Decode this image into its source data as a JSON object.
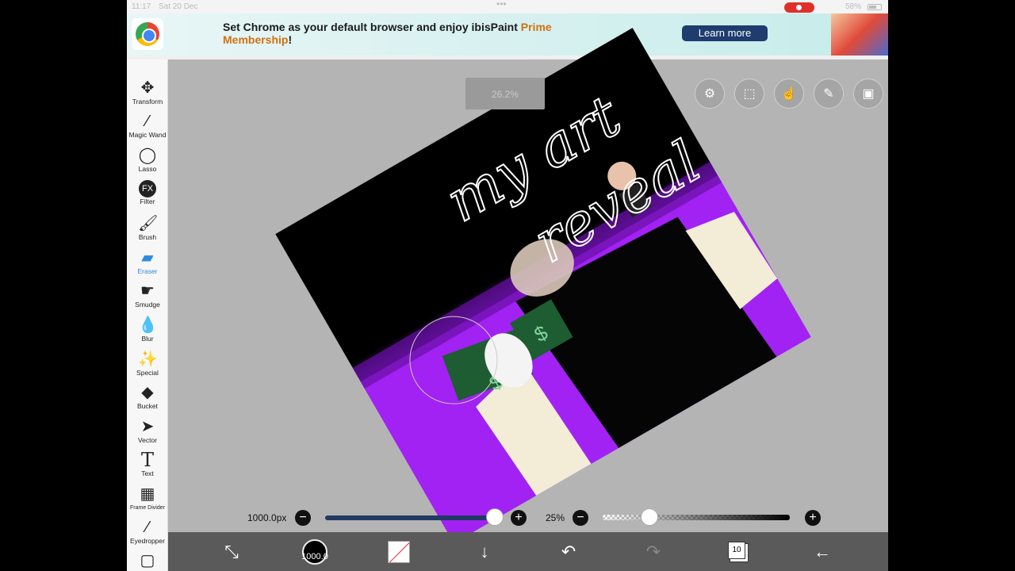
{
  "status_bar": {
    "time": "11:17",
    "date": "Sat 20 Dec",
    "battery": "58%"
  },
  "ad": {
    "message_prefix": "Set Chrome as your default browser and enjoy ibisPaint ",
    "message_highlight_1": "Prime",
    "message_highlight_2": "Membership",
    "message_suffix": "!",
    "button_label": "Learn more"
  },
  "toolbar": {
    "items": [
      {
        "label": "Transform",
        "icon": "move-arrows-icon"
      },
      {
        "label": "Magic Wand",
        "icon": "magic-wand-icon"
      },
      {
        "label": "Lasso",
        "icon": "lasso-icon"
      },
      {
        "label": "Filter",
        "icon": "fx-icon"
      },
      {
        "label": "Brush",
        "icon": "brush-icon"
      },
      {
        "label": "Eraser",
        "icon": "eraser-icon",
        "active": true
      },
      {
        "label": "Smudge",
        "icon": "smudge-icon"
      },
      {
        "label": "Blur",
        "icon": "drop-icon"
      },
      {
        "label": "Special",
        "icon": "sparkle-pen-icon"
      },
      {
        "label": "Bucket",
        "icon": "bucket-icon"
      },
      {
        "label": "Vector",
        "icon": "cursor-icon"
      },
      {
        "label": "Text",
        "icon": "text-icon"
      },
      {
        "label": "Frame Divider",
        "icon": "frame-divider-icon"
      },
      {
        "label": "Eyedropper",
        "icon": "eyedropper-icon"
      }
    ]
  },
  "canvas": {
    "zoom_badge": "26.2%",
    "art_text_line1": "my art",
    "art_text_line2": "reveal"
  },
  "sliders": {
    "brush_size_label": "1000.0px",
    "brush_size_fraction": 1.0,
    "opacity_label": "25%",
    "opacity_fraction": 0.25
  },
  "bottom_bar": {
    "color_label": "1000.0",
    "layer_count": "10"
  }
}
